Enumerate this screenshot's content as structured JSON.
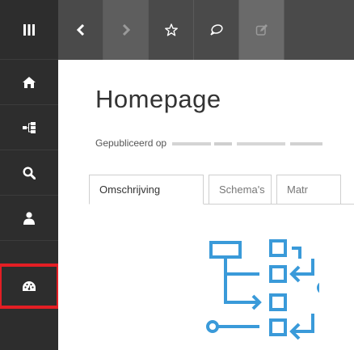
{
  "sidebar": {
    "items": [
      {
        "icon": "menu-icon"
      },
      {
        "icon": "home-icon"
      },
      {
        "icon": "hierarchy-icon"
      },
      {
        "icon": "search-icon"
      },
      {
        "icon": "user-icon"
      },
      {
        "icon": "dashboard-icon",
        "highlighted": true
      }
    ]
  },
  "toolbar": {
    "buttons": [
      {
        "icon": "chevron-left-icon"
      },
      {
        "icon": "chevron-right-icon"
      },
      {
        "icon": "star-icon"
      },
      {
        "icon": "comment-icon"
      },
      {
        "icon": "edit-icon"
      }
    ]
  },
  "page": {
    "title": "Homepage",
    "published_label": "Gepubliceerd op"
  },
  "tabs": [
    {
      "label": "Omschrijving",
      "active": true
    },
    {
      "label": "Schema's",
      "active": false
    },
    {
      "label": "Matr",
      "active": false
    }
  ],
  "colors": {
    "sidebar_bg": "#2d2d2d",
    "toolbar_bg": "#4a4a4a",
    "highlight": "#e31e24",
    "diagram": "#3a9ad9"
  }
}
